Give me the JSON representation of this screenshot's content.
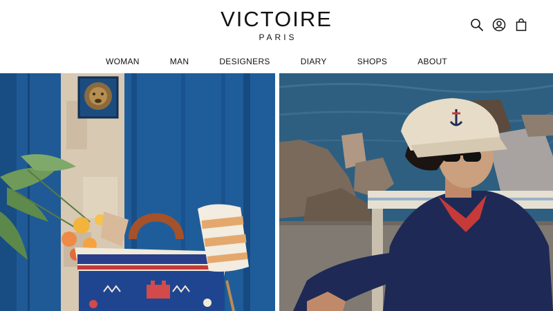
{
  "brand": {
    "name": "VICTOIRE",
    "subtitle": "PARIS"
  },
  "header_icons": [
    "search-icon",
    "account-icon",
    "bag-icon"
  ],
  "nav": {
    "items": [
      {
        "label": "WOMAN"
      },
      {
        "label": "MAN"
      },
      {
        "label": "DESIGNERS"
      },
      {
        "label": "DIARY"
      },
      {
        "label": "SHOPS"
      },
      {
        "label": "ABOUT"
      }
    ]
  },
  "hero": {
    "panels": [
      {
        "name": "woman-collection",
        "scene": "blue-door-with-woven-basket-bag"
      },
      {
        "name": "man-collection",
        "scene": "man-in-cap-by-the-sea"
      }
    ]
  },
  "colors": {
    "door_blue": "#1f5d9a",
    "sweater_navy": "#1e2a55",
    "sea_blue": "#2e5f80"
  }
}
